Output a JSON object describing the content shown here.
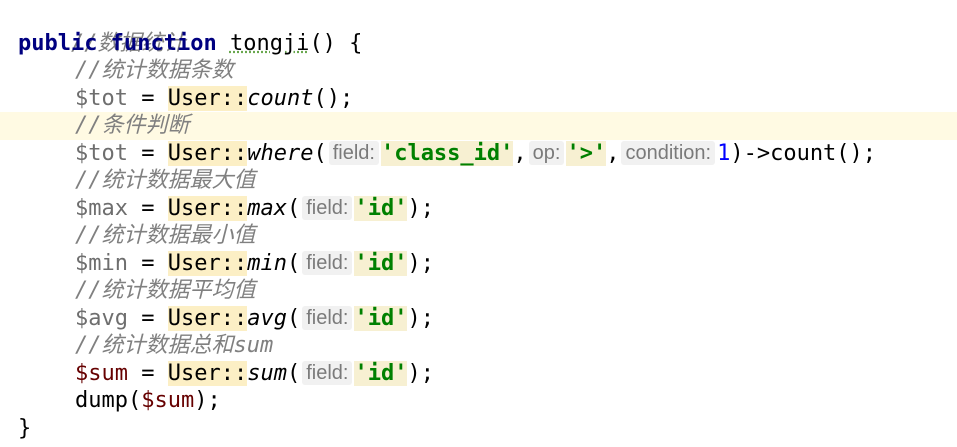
{
  "code": {
    "l1_comment": "//数据统计",
    "l2_public": "public",
    "l2_function": "function",
    "l2_name": "tongji",
    "l2_rest": "() {",
    "l3_comment": "//统计数据条数",
    "l4_var": "$tot",
    "l4_eq": " = ",
    "l4_class": "User",
    "l4_sep": "::",
    "l4_method": "count",
    "l4_rest": "();",
    "l5_comment": "//条件判断",
    "l6_var": "$tot",
    "l6_eq": " = ",
    "l6_class": "User",
    "l6_sep": "::",
    "l6_method": "where",
    "l6_open": "(",
    "l6_hint1": "field:",
    "l6_arg1": "'class_id'",
    "l6_comma1": ",",
    "l6_hint2": "op:",
    "l6_arg2": "'>'",
    "l6_comma2": ",",
    "l6_hint3": "condition:",
    "l6_arg3": "1",
    "l6_rest": ")->count();",
    "l7_comment": "//统计数据最大值",
    "l8_var": "$max",
    "l8_eq": " = ",
    "l8_class": "User",
    "l8_sep": "::",
    "l8_method": "max",
    "l8_open": "(",
    "l8_hint": "field:",
    "l8_arg": "'id'",
    "l8_rest": ");",
    "l9_comment": "//统计数据最小值",
    "l10_var": "$min",
    "l10_eq": " = ",
    "l10_class": "User",
    "l10_sep": "::",
    "l10_method": "min",
    "l10_open": "(",
    "l10_hint": "field:",
    "l10_arg": "'id'",
    "l10_rest": ");",
    "l11_comment": "//统计数据平均值",
    "l12_var": "$avg",
    "l12_eq": " = ",
    "l12_class": "User",
    "l12_sep": "::",
    "l12_method": "avg",
    "l12_open": "(",
    "l12_hint": "field:",
    "l12_arg": "'id'",
    "l12_rest": ");",
    "l13_comment": "//统计数据总和sum",
    "l14_var": "$sum",
    "l14_eq": " = ",
    "l14_class": "User",
    "l14_sep": "::",
    "l14_method": "sum",
    "l14_open": "(",
    "l14_hint": "field:",
    "l14_arg": "'id'",
    "l14_rest": ");",
    "l15_fn": "dump(",
    "l15_var": "$sum",
    "l15_rest": ");",
    "l16_close": "}"
  },
  "colors": {
    "keyword": "#000080",
    "comment": "#808080",
    "string": "#008000",
    "number": "#0000ff",
    "variable_used": "#660000",
    "variable_unused": "#6e6e6e",
    "current_line": "#fffae3",
    "class_highlight": "#fcefc5",
    "hint_background": "#f1f1f1"
  }
}
